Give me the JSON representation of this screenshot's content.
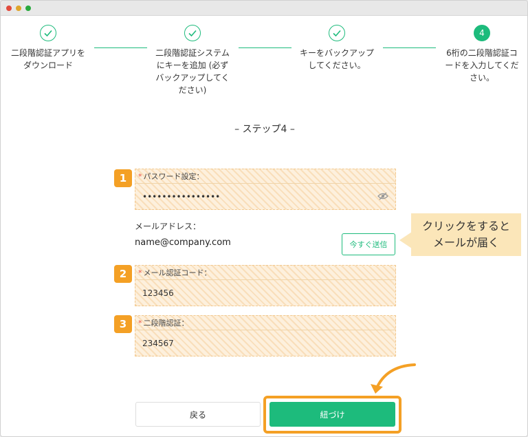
{
  "steps": [
    {
      "number": "",
      "label": "二段階認証アプリを\nダウンロード",
      "state": "done"
    },
    {
      "number": "",
      "label": "二段階認証システム\nにキーを追加 (必ず\nバックアップしてく\nださい)",
      "state": "done"
    },
    {
      "number": "",
      "label": "キーをバックアップ\nしてください。",
      "state": "done"
    },
    {
      "number": "4",
      "label": "6桁の二段階認証コ\nードを入力してくだ\nさい。",
      "state": "active"
    }
  ],
  "step_title": "– ステップ4 –",
  "form": {
    "password": {
      "badge": "1",
      "required": "*",
      "label": "パスワード設定：",
      "value": "••••••••••••••••"
    },
    "email": {
      "label": "メールアドレス：",
      "value": "name@company.com",
      "send_label": "今すぐ送信"
    },
    "mail_code": {
      "badge": "2",
      "required": "*",
      "label": "メール認証コード：",
      "value": "123456"
    },
    "two_factor": {
      "badge": "3",
      "required": "*",
      "label": "二段階認証：",
      "value": "234567"
    }
  },
  "callout": {
    "line1": "クリックをすると",
    "line2": "メールが届く"
  },
  "buttons": {
    "back": "戻る",
    "bind": "紐づけ"
  },
  "colors": {
    "accent": "#1dbb7c",
    "highlight": "#f4a025",
    "callout_bg": "#fbe6b9"
  }
}
